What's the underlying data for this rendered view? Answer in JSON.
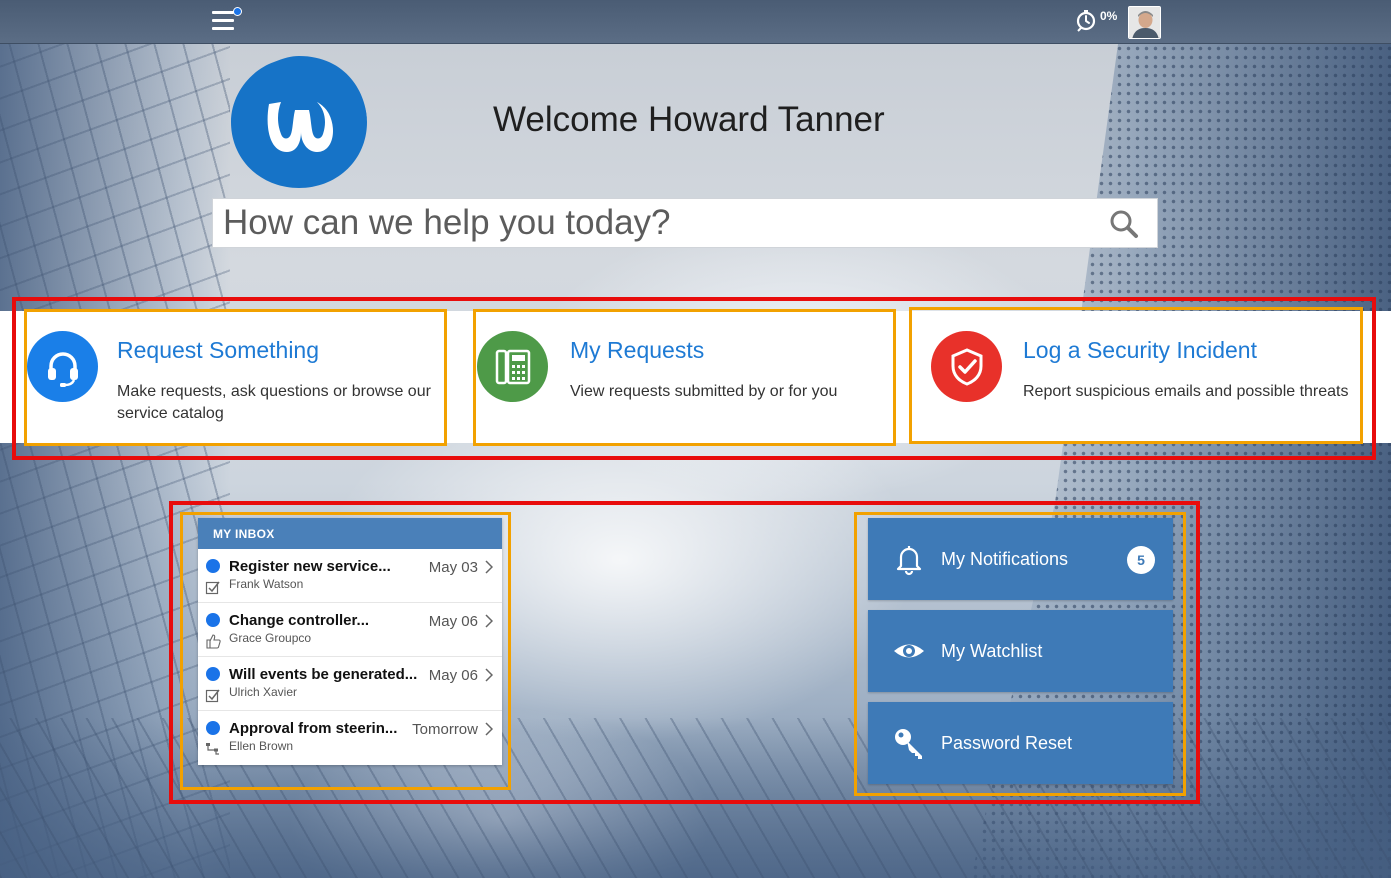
{
  "header": {
    "timer_label": "0%"
  },
  "hero": {
    "welcome": "Welcome Howard Tanner",
    "search_placeholder": "How can we help you today?"
  },
  "tiles": [
    {
      "title": "Request Something",
      "description": "Make requests, ask questions or browse our service catalog",
      "icon": "headset-icon",
      "color": "#1a7fe8"
    },
    {
      "title": "My Requests",
      "description": "View requests submitted by or for you",
      "icon": "phone-icon",
      "color": "#4e9a48"
    },
    {
      "title": "Log a Security Incident",
      "description": "Report suspicious emails and possible threats",
      "icon": "shield-check-icon",
      "color": "#e8312a"
    }
  ],
  "inbox": {
    "header": "MY INBOX",
    "items": [
      {
        "title": "Register new service...",
        "subtitle": "Frank Watson",
        "date": "May 03",
        "icon": "checkbox-icon"
      },
      {
        "title": "Change controller...",
        "subtitle": "Grace Groupco",
        "date": "May 06",
        "icon": "thumbs-up-icon"
      },
      {
        "title": "Will events be generated...",
        "subtitle": "Ulrich Xavier",
        "date": "May 06",
        "icon": "checkbox-icon"
      },
      {
        "title": "Approval from steerin...",
        "subtitle": "Ellen Brown",
        "date": "Tomorrow",
        "icon": "workflow-icon"
      }
    ]
  },
  "side_buttons": [
    {
      "label": "My Notifications",
      "icon": "bell-icon",
      "badge": "5"
    },
    {
      "label": "My Watchlist",
      "icon": "eye-icon"
    },
    {
      "label": "Password Reset",
      "icon": "key-icon"
    }
  ],
  "colors": {
    "topbar": "#4a5c74",
    "accent_blue": "#1e7ad4",
    "side_button": "#3e7ab7",
    "highlight_red": "#e80c0c",
    "highlight_orange": "#f2a100"
  }
}
